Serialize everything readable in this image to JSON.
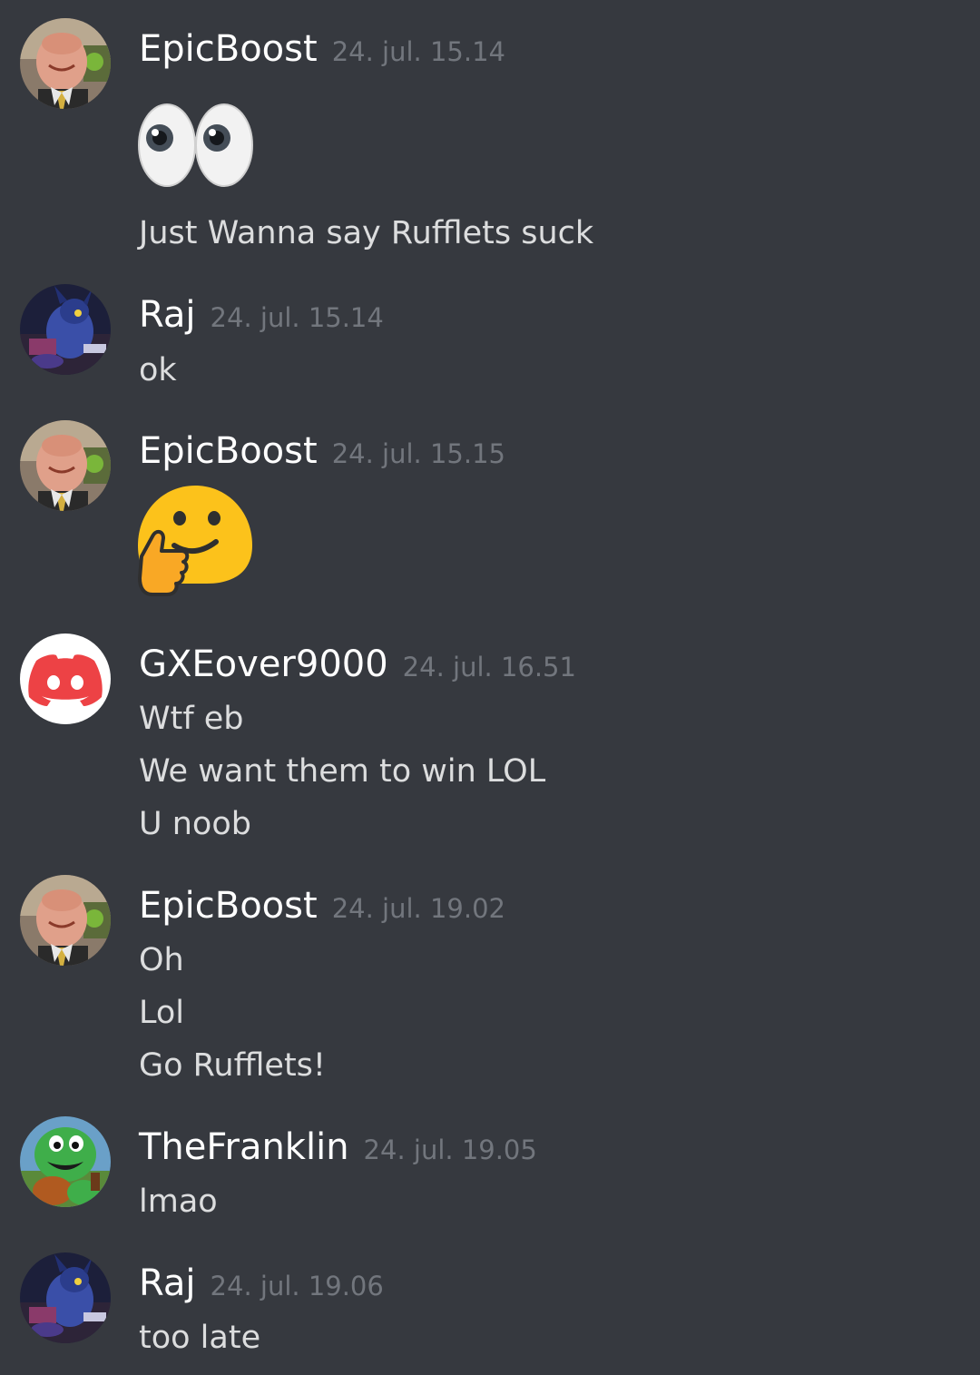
{
  "messages": [
    {
      "author": "EpicBoost",
      "avatar": "office-man-avatar",
      "time": "24. jul. 15.14",
      "emoji": "eyes-icon",
      "lines": [
        "Just Wanna say Rufflets suck"
      ]
    },
    {
      "author": "Raj",
      "avatar": "dark-creature-avatar",
      "time": "24. jul. 15.14",
      "lines": [
        "ok"
      ]
    },
    {
      "author": "EpicBoost",
      "avatar": "office-man-avatar",
      "time": "24. jul. 15.15",
      "emoji": "thumbs-up-smiley-icon",
      "lines": []
    },
    {
      "author": "GXEover9000",
      "avatar": "discord-default-avatar",
      "time": "24. jul. 16.51",
      "lines": [
        "Wtf eb",
        "We want them to win LOL",
        "U noob"
      ]
    },
    {
      "author": "EpicBoost",
      "avatar": "office-man-avatar",
      "time": "24. jul. 19.02",
      "lines": [
        "Oh",
        "Lol",
        "Go Rufflets!"
      ]
    },
    {
      "author": "TheFranklin",
      "avatar": "green-turtle-avatar",
      "time": "24. jul. 19.05",
      "lines": [
        "lmao"
      ]
    },
    {
      "author": "Raj",
      "avatar": "dark-creature-avatar",
      "time": "24. jul. 19.06",
      "lines": [
        "too late"
      ]
    }
  ],
  "colors": {
    "background": "#36393f",
    "username": "#ffffff",
    "timestamp": "#72767d",
    "text": "#dcddde",
    "discord_red": "#ed4245"
  }
}
